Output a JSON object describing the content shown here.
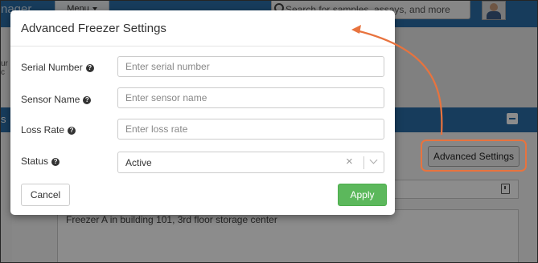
{
  "app": {
    "brand_fragment": "nager",
    "menu_label": "Menu",
    "search_placeholder": "Search for samples, assays, and more",
    "side_fragment": "ur c",
    "panel_fragment": "s",
    "advanced_settings_label": "Advanced Settings",
    "description_text": "Freezer A in building 101, 3rd floor storage center"
  },
  "modal": {
    "title": "Advanced Freezer Settings",
    "fields": [
      {
        "label": "Serial Number",
        "placeholder": "Enter serial number",
        "value": ""
      },
      {
        "label": "Sensor Name",
        "placeholder": "Enter sensor name",
        "value": ""
      },
      {
        "label": "Loss Rate",
        "placeholder": "Enter loss rate",
        "value": ""
      }
    ],
    "status": {
      "label": "Status",
      "value": "Active"
    },
    "help_glyph": "?",
    "clear_glyph": "×",
    "cancel_label": "Cancel",
    "apply_label": "Apply"
  },
  "colors": {
    "header_blue": "#2b6ea8",
    "apply_green": "#5cb85c",
    "callout_orange": "#e8733e"
  }
}
